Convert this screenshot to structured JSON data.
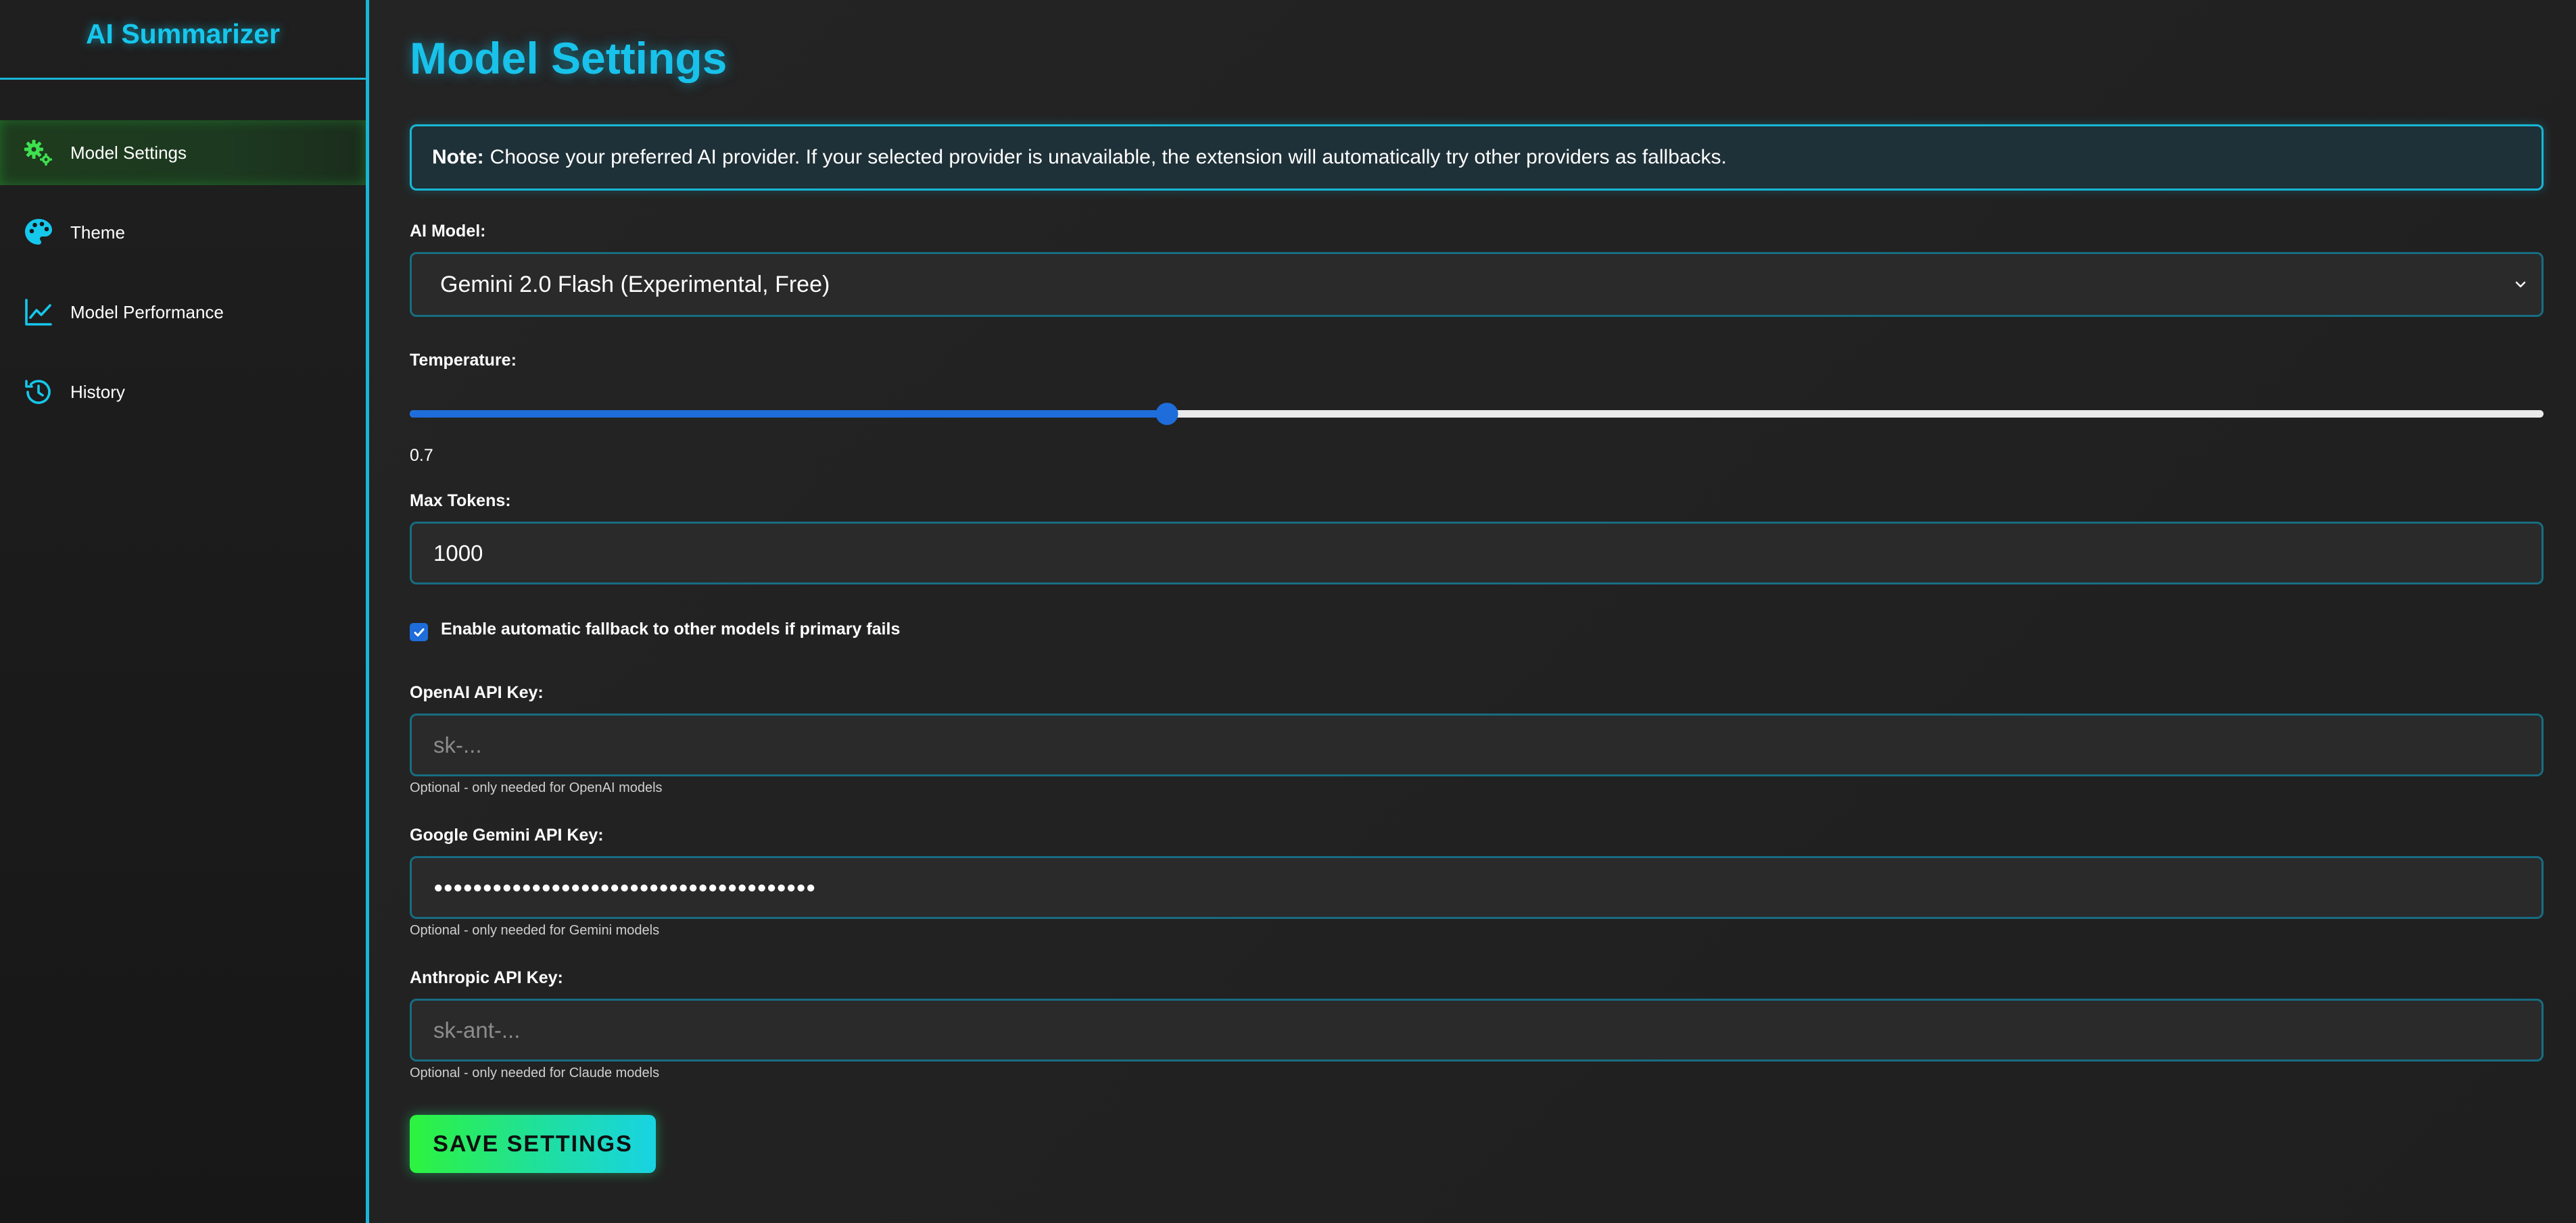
{
  "sidebar": {
    "title": "AI Summarizer",
    "items": [
      {
        "label": "Model Settings",
        "icon": "gears-icon",
        "active": true
      },
      {
        "label": "Theme",
        "icon": "palette-icon",
        "active": false
      },
      {
        "label": "Model Performance",
        "icon": "line-chart-icon",
        "active": false
      },
      {
        "label": "History",
        "icon": "history-icon",
        "active": false
      }
    ]
  },
  "main": {
    "title": "Model Settings",
    "note": {
      "label": "Note:",
      "text": "Choose your preferred AI provider. If your selected provider is unavailable, the extension will automatically try other providers as fallbacks."
    },
    "model": {
      "label": "AI Model:",
      "selected": "Gemini 2.0 Flash (Experimental, Free)"
    },
    "temperature": {
      "label": "Temperature:",
      "value_text": "0.7",
      "fraction": 0.355
    },
    "max_tokens": {
      "label": "Max Tokens:",
      "value": "1000"
    },
    "fallback": {
      "label": "Enable automatic fallback to other models if primary fails",
      "checked": true
    },
    "openai": {
      "label": "OpenAI API Key:",
      "placeholder": "sk-...",
      "value": "",
      "hint": "Optional - only needed for OpenAI models"
    },
    "gemini": {
      "label": "Google Gemini API Key:",
      "placeholder": "",
      "value": "●●●●●●●●●●●●●●●●●●●●●●●●●●●●●●●●●●●●●●●",
      "hint": "Optional - only needed for Gemini models"
    },
    "anthropic": {
      "label": "Anthropic API Key:",
      "placeholder": "sk-ant-...",
      "value": "",
      "hint": "Optional - only needed for Claude models"
    },
    "save_label": "SAVE SETTINGS"
  },
  "colors": {
    "accent_cyan": "#18c2ea",
    "active_green": "#2df33d",
    "slider_blue": "#1e6ddb",
    "background": "#222222"
  }
}
